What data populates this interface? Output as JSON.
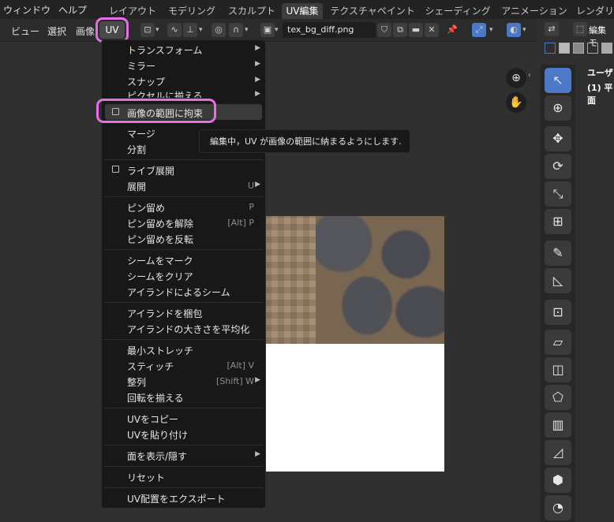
{
  "topbar": {
    "menus": [
      "ウィンドウ",
      "ヘルプ"
    ],
    "workspace_tabs": [
      "レイアウト",
      "モデリング",
      "スカルプト",
      "UV編集",
      "テクスチャペイント",
      "シェーディング",
      "アニメーション",
      "レンダリ"
    ],
    "active_tab": "UV編集"
  },
  "header": {
    "menus": [
      "ビュー",
      "選択",
      "画像"
    ],
    "uv_menu": "UV",
    "image_name": "tex_bg_diff.png",
    "pin_icon": "pin-icon"
  },
  "side_panel": {
    "header_label": "編集モ",
    "user_label": "ユーザ",
    "object_label": "(1) 平面"
  },
  "uv_menu_items": [
    {
      "label": "トランスフォーム",
      "submenu": true
    },
    {
      "label": "ミラー",
      "submenu": true
    },
    {
      "label": "スナップ",
      "submenu": true
    },
    {
      "label": "ピクセルに揃える",
      "submenu": true
    },
    {
      "label": "画像の範囲に拘束",
      "checkbox": true,
      "highlighted": true
    },
    {
      "label": "マージ"
    },
    {
      "label": "分割"
    },
    {
      "label": "ライブ展開",
      "checkbox": true
    },
    {
      "label": "展開",
      "shortcut": "U"
    },
    {
      "label": "ピン留め",
      "shortcut": "P"
    },
    {
      "label": "ピン留めを解除",
      "shortcut": "[Alt] P"
    },
    {
      "label": "ピン留めを反転"
    },
    {
      "label": "シームをマーク"
    },
    {
      "label": "シームをクリア"
    },
    {
      "label": "アイランドによるシーム"
    },
    {
      "label": "アイランドを梱包"
    },
    {
      "label": "アイランドの大きさを平均化"
    },
    {
      "label": "最小ストレッチ"
    },
    {
      "label": "スティッチ",
      "shortcut": "[Alt] V"
    },
    {
      "label": "整列",
      "shortcut": "[Shift] W"
    },
    {
      "label": "回転を揃える"
    },
    {
      "label": "UVをコピー"
    },
    {
      "label": "UVを貼り付け"
    },
    {
      "label": "面を表示/隠す",
      "submenu": true
    },
    {
      "label": "リセット"
    },
    {
      "label": "UV配置をエクスポート"
    }
  ],
  "tooltip": "編集中，UV が画像の範囲に納まるようにします.",
  "colors": {
    "highlight_outline": "#e86ee6",
    "active_tool": "#4b79c8"
  }
}
